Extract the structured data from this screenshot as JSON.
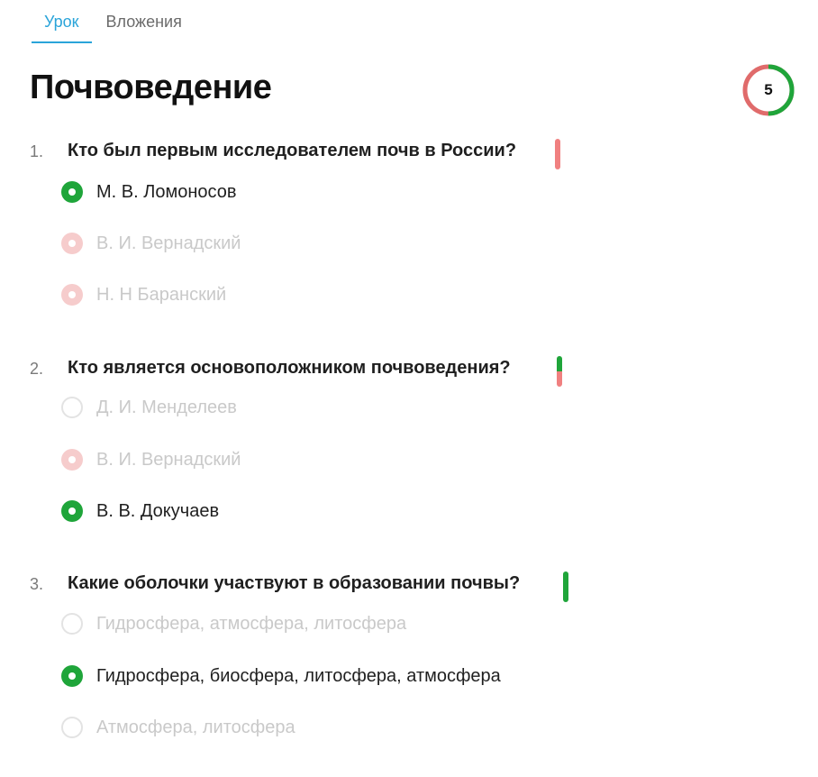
{
  "tabs": [
    {
      "label": "Урок",
      "active": true
    },
    {
      "label": "Вложения",
      "active": false
    }
  ],
  "lesson": {
    "title": "Почвоведение",
    "score": "5",
    "score_ring": {
      "correct_fraction": 0.5,
      "colors": {
        "correct": "#1fa53a",
        "wrong": "#e06b6b"
      }
    }
  },
  "questions": [
    {
      "number": "1.",
      "text": "Кто был первым исследователем почв в России?",
      "result": {
        "correct": 0,
        "wrong": 1
      },
      "options": [
        {
          "label": "М. В. Ломоносов",
          "state": "correct"
        },
        {
          "label": "В. И. Вернадский",
          "state": "wrong"
        },
        {
          "label": "Н. Н Баранский",
          "state": "wrong"
        }
      ]
    },
    {
      "number": "2.",
      "text": "Кто является основоположником почвоведения?",
      "result": {
        "correct": 0.5,
        "wrong": 0.5
      },
      "options": [
        {
          "label": "Д. И. Менделеев",
          "state": "empty"
        },
        {
          "label": "В. И. Вернадский",
          "state": "wrong"
        },
        {
          "label": "В. В. Докучаев",
          "state": "correct"
        }
      ]
    },
    {
      "number": "3.",
      "text": "Какие оболочки участвуют в образовании почвы?",
      "result": {
        "correct": 1,
        "wrong": 0
      },
      "options": [
        {
          "label": "Гидросфера, атмосфера, литосфера",
          "state": "empty"
        },
        {
          "label": "Гидросфера, биосфера, литосфера, атмосфера",
          "state": "correct"
        },
        {
          "label": "Атмосфера, литосфера",
          "state": "empty"
        }
      ]
    }
  ],
  "colors": {
    "accent": "#2aa4d9",
    "correct": "#1fa53a",
    "wrong": "#f08080",
    "wrong_light": "#f6cccc"
  }
}
